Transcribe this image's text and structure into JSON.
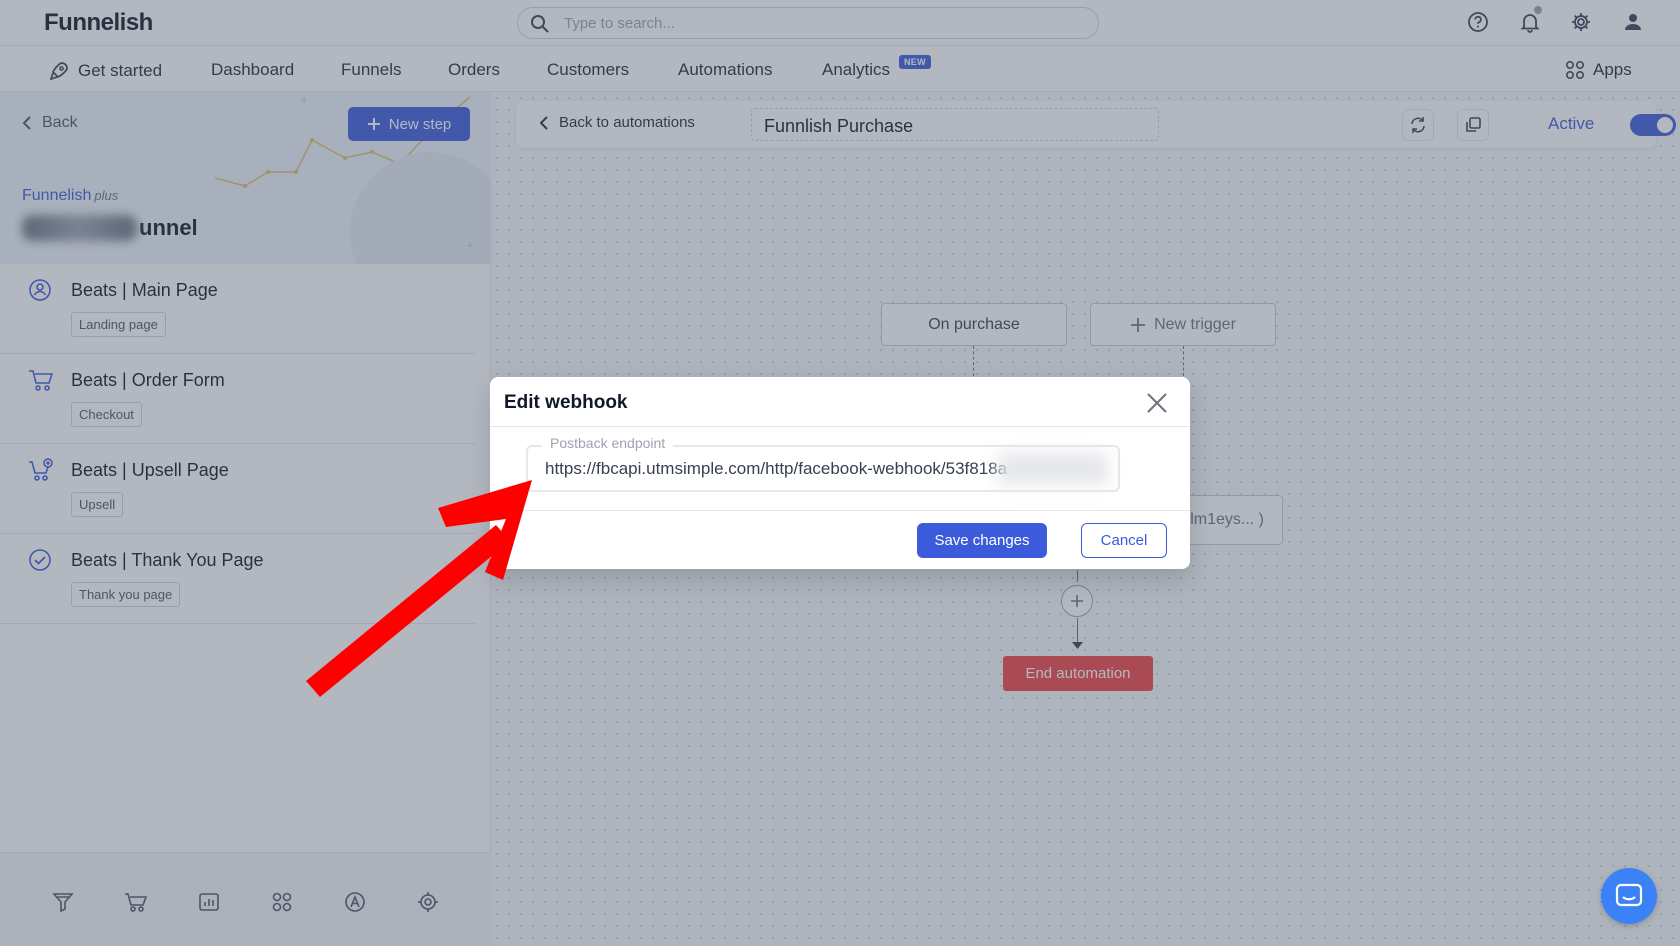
{
  "app": {
    "logo": "Funnelish",
    "search_placeholder": "Type to search..."
  },
  "nav": {
    "items": [
      "Get started",
      "Dashboard",
      "Funnels",
      "Orders",
      "Customers",
      "Automations",
      "Analytics"
    ],
    "new_badge": "NEW",
    "apps_label": "Apps"
  },
  "sidebar": {
    "back_label": "Back",
    "new_step_label": "New step",
    "brand": "Funnelish",
    "brand_suffix": "plus",
    "funnel_name_visible": "unnel",
    "steps": [
      {
        "title": "Beats | Main Page",
        "tag": "Landing page",
        "icon": "landing-page-icon"
      },
      {
        "title": "Beats | Order Form",
        "tag": "Checkout",
        "icon": "cart-icon"
      },
      {
        "title": "Beats | Upsell Page",
        "tag": "Upsell",
        "icon": "upsell-cart-icon"
      },
      {
        "title": "Beats | Thank You Page",
        "tag": "Thank you page",
        "icon": "check-circle-icon"
      }
    ],
    "footer_icons": [
      "funnel-icon",
      "cart-icon",
      "chart-icon",
      "apps-icon",
      "automation-icon",
      "gear-icon"
    ]
  },
  "automation": {
    "back_label": "Back to automations",
    "name": "Funnlish Purchase",
    "active_label": "Active",
    "active": true,
    "trigger_label": "On purchase",
    "new_trigger_label": "New trigger",
    "partial_node_label": "lm1eys... )",
    "end_label": "End automation"
  },
  "modal": {
    "title": "Edit webhook",
    "field_label": "Postback endpoint",
    "field_value": "https://fbcapi.utmsimple.com/http/facebook-webhook/53f818a",
    "save_label": "Save changes",
    "cancel_label": "Cancel"
  },
  "colors": {
    "primary": "#3b5bdb",
    "danger": "#ef4444",
    "annotation_arrow": "#ff0000"
  }
}
